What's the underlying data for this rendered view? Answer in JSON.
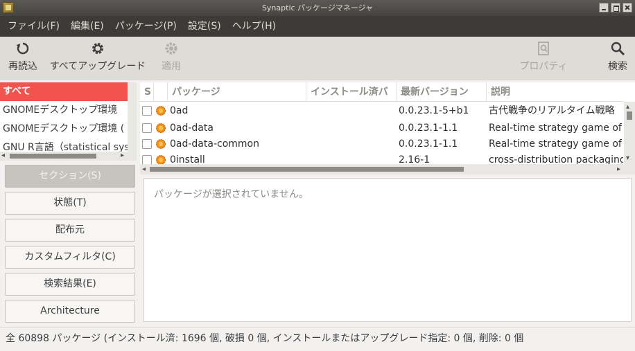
{
  "window": {
    "title": "Synaptic パッケージマネージャ"
  },
  "menubar": [
    "ファイル(F)",
    "編集(E)",
    "パッケージ(P)",
    "設定(S)",
    "ヘルプ(H)"
  ],
  "toolbar": {
    "reload": "再読込",
    "upgrade_all": "すべてアップグレード",
    "apply": "適用",
    "properties": "プロパティ",
    "search": "検索"
  },
  "sections_list": [
    "すべて",
    "GNOMEデスクトップ環境",
    "GNOMEデスクトップ環境 (",
    "GNU R言語（statistical sys"
  ],
  "filter_buttons": [
    "セクション(S)",
    "状態(T)",
    "配布元",
    "カスタムフィルタ(C)",
    "検索結果(E)",
    "Architecture"
  ],
  "package_table": {
    "headers": [
      "S",
      "",
      "パッケージ",
      "インストール済バ",
      "最新バージョン",
      "説明"
    ],
    "rows": [
      {
        "name": "0ad",
        "installed": "",
        "latest": "0.0.23.1-5+b1",
        "description": "古代戦争のリアルタイム戦略"
      },
      {
        "name": "0ad-data",
        "installed": "",
        "latest": "0.0.23.1-1.1",
        "description": "Real-time strategy game of a"
      },
      {
        "name": "0ad-data-common",
        "installed": "",
        "latest": "0.0.23.1-1.1",
        "description": "Real-time strategy game of a"
      },
      {
        "name": "0install",
        "installed": "",
        "latest": "2.16-1",
        "description": "cross-distribution packaging"
      }
    ]
  },
  "detail": {
    "message": "パッケージが選択されていません。"
  },
  "status": "全 60898 パッケージ (インストール済: 1696 個, 破損 0 個, インストールまたはアップグレード指定: 0 個, 削除: 0 個",
  "colors": {
    "selected_row": "#f0544c",
    "menubar_bg": "#3c3b37",
    "toolbar_bg": "#dfdcd7"
  }
}
